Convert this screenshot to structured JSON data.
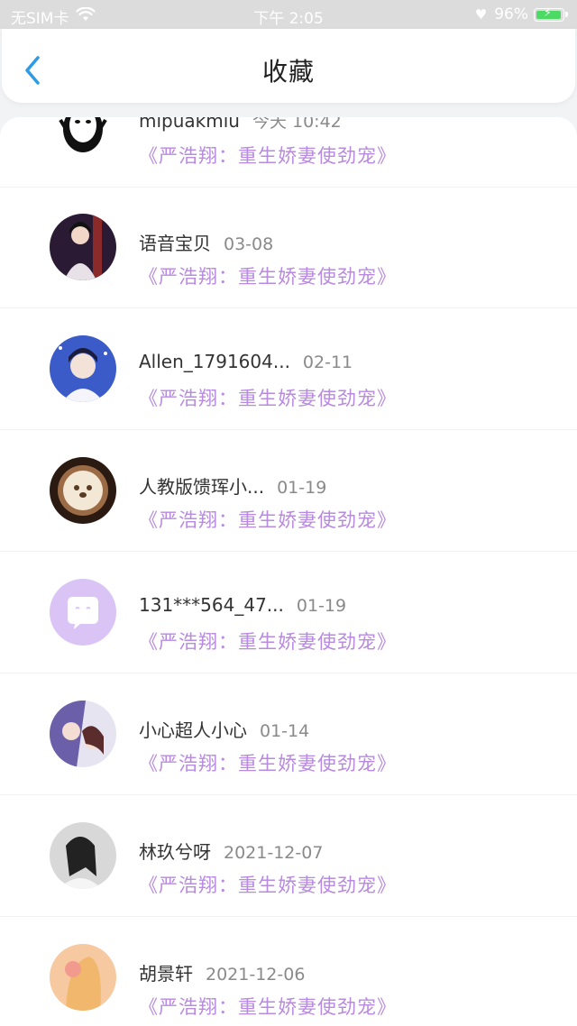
{
  "status_bar": {
    "carrier": "无SIM卡",
    "time": "下午 2:05",
    "battery": "96%",
    "battery_level": 0.96
  },
  "header": {
    "title": "收藏",
    "back_icon": "chevron-left-icon"
  },
  "colors": {
    "accent": "#2f9be6",
    "work_title": "#b88ae0"
  },
  "favorites": [
    {
      "name": "mipuakmiu",
      "date": "今天 10:42",
      "work": "《严浩翔：重生娇妻使劲宠》"
    },
    {
      "name": "语音宝贝",
      "date": "03-08",
      "work": "《严浩翔：重生娇妻使劲宠》"
    },
    {
      "name": "Allen_1791604...",
      "date": "02-11",
      "work": "《严浩翔：重生娇妻使劲宠》"
    },
    {
      "name": "人教版馈珲小...",
      "date": "01-19",
      "work": "《严浩翔：重生娇妻使劲宠》"
    },
    {
      "name": "131***564_47...",
      "date": "01-19",
      "work": "《严浩翔：重生娇妻使劲宠》"
    },
    {
      "name": "小心超人小心",
      "date": "01-14",
      "work": "《严浩翔：重生娇妻使劲宠》"
    },
    {
      "name": "林玖兮呀",
      "date": "2021-12-07",
      "work": "《严浩翔：重生娇妻使劲宠》"
    },
    {
      "name": "胡景轩",
      "date": "2021-12-06",
      "work": "《严浩翔：重生娇妻使劲宠》"
    }
  ]
}
